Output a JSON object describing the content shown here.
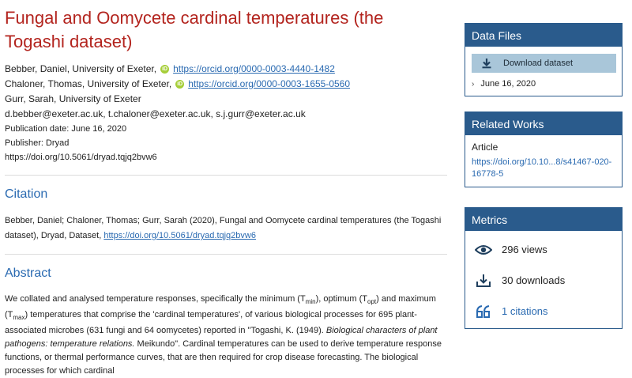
{
  "dataset": {
    "title": "Fungal and Oomycete cardinal temperatures (the Togashi dataset)",
    "authors": [
      {
        "text": "Bebber, Daniel, University of Exeter,",
        "orcid": "https://orcid.org/0000-0003-4440-1482"
      },
      {
        "text": "Chaloner, Thomas, University of Exeter,",
        "orcid": "https://orcid.org/0000-0003-1655-0560"
      },
      {
        "text": "Gurr, Sarah, University of Exeter"
      }
    ],
    "emails": "d.bebber@exeter.ac.uk, t.chaloner@exeter.ac.uk, s.j.gurr@exeter.ac.uk",
    "publication_date": "Publication date: June 16, 2020",
    "publisher": "Publisher: Dryad",
    "doi": "https://doi.org/10.5061/dryad.tqjq2bvw6"
  },
  "citation": {
    "heading": "Citation",
    "text": "Bebber, Daniel; Chaloner, Thomas; Gurr, Sarah (2020), Fungal and Oomycete cardinal temperatures (the Togashi dataset), Dryad, Dataset,",
    "doi": "https://doi.org/10.5061/dryad.tqjq2bvw6"
  },
  "abstract": {
    "heading": "Abstract",
    "p1": "We collated and analysed temperature responses, specifically the minimum (T",
    "sub_min": "min",
    "p2": "), optimum (T",
    "sub_opt": "opt",
    "p3": ") and maximum (T",
    "sub_max": "max",
    "p4": ") temperatures that comprise the 'cardinal temperatures', of various biological processes for 695 plant-associated microbes (631 fungi and 64 oomycetes) reported in \"Togashi, K. (1949). ",
    "italic": "Biological characters of plant pathogens: temperature relations.",
    "p5": " Meikundo\". Cardinal temperatures can be used to derive temperature response functions, or thermal performance curves, that are then required for crop disease forecasting. The biological processes for which cardinal"
  },
  "sidebar": {
    "data_files": {
      "heading": "Data Files",
      "download_label": "Download dataset",
      "version_date": "June 16, 2020"
    },
    "related_works": {
      "heading": "Related Works",
      "label": "Article",
      "link": "https://doi.org/10.10...8/s41467-020-16778-5"
    },
    "metrics": {
      "heading": "Metrics",
      "views": "296 views",
      "downloads": "30 downloads",
      "citations": "1 citations"
    },
    "colors": {
      "panel_header": "#2a5b8c",
      "button": "#a9c6d9",
      "title": "#b3241e",
      "link": "#2a6ab1"
    }
  }
}
